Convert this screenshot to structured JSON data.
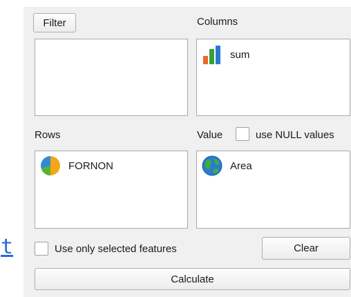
{
  "background_link": {
    "text": "t"
  },
  "filter": {
    "button_label": "Filter"
  },
  "columns": {
    "label": "Columns",
    "items": [
      {
        "label": "sum",
        "icon": "bar-chart-icon"
      }
    ]
  },
  "rows": {
    "label": "Rows",
    "items": [
      {
        "label": "FORNON",
        "icon": "pie-chart-icon"
      }
    ]
  },
  "value": {
    "label": "Value",
    "use_null_label": "use NULL values",
    "use_null_checked": false,
    "items": [
      {
        "label": "Area",
        "icon": "globe-icon"
      }
    ]
  },
  "options": {
    "selected_only_label": "Use only selected features",
    "selected_only_checked": false,
    "clear_label": "Clear",
    "calculate_label": "Calculate"
  },
  "colors": {
    "panel_bg": "#f0f0f0",
    "link": "#2a6ad8"
  }
}
